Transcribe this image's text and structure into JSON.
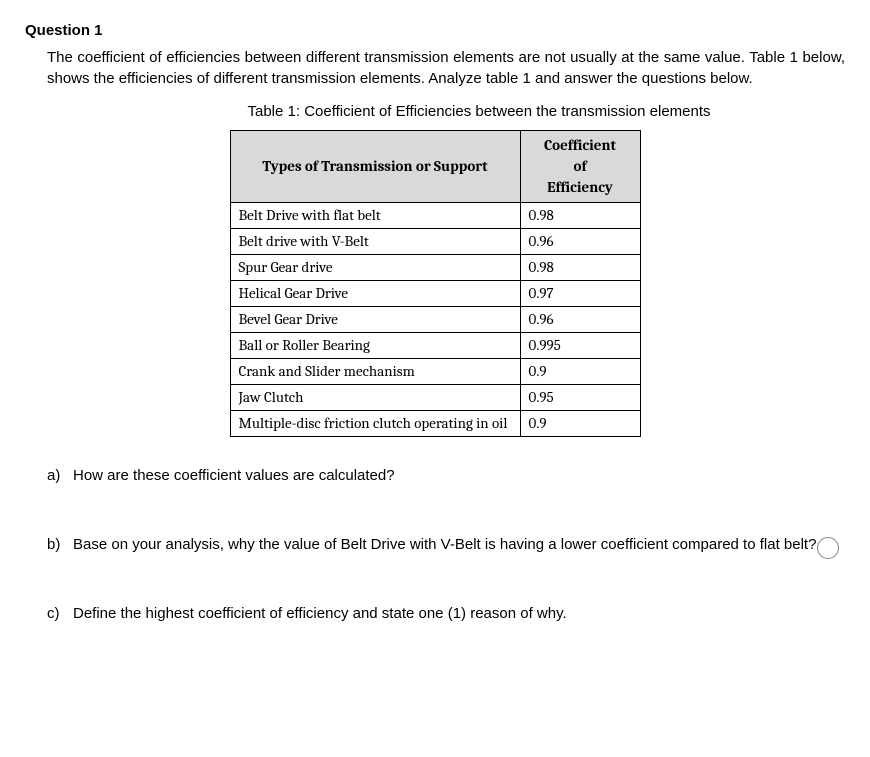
{
  "question_title": "Question 1",
  "intro": "The coefficient of efficiencies between different transmission elements are not usually at the same value. Table 1 below, shows the efficiencies of different transmission elements. Analyze table 1 and answer the questions below.",
  "table_caption": "Table 1: Coefficient of Efficiencies between the transmission elements",
  "headers": {
    "col1": "Types of Transmission or Support",
    "col2_line1": "Coefficient",
    "col2_line2": "of",
    "col2_line3": "Efficiency"
  },
  "rows": [
    {
      "type": "Belt Drive with flat belt",
      "coef": "0.98"
    },
    {
      "type": "Belt drive with V-Belt",
      "coef": "0.96"
    },
    {
      "type": "Spur Gear drive",
      "coef": "0.98"
    },
    {
      "type": "Helical Gear Drive",
      "coef": "0.97"
    },
    {
      "type": "Bevel Gear Drive",
      "coef": "0.96"
    },
    {
      "type": "Ball or Roller Bearing",
      "coef": "0.995"
    },
    {
      "type": "Crank and Slider mechanism",
      "coef": "0.9"
    },
    {
      "type": "Jaw Clutch",
      "coef": "0.95"
    },
    {
      "type": "Multiple-disc friction clutch operating in oil",
      "coef": "0.9"
    }
  ],
  "parts": {
    "a": {
      "marker": "a)",
      "text": "How are these coefficient values are calculated?"
    },
    "b": {
      "marker": "b)",
      "text": "Base on your analysis, why the value of Belt Drive with V-Belt is having a lower coefficient compared to flat belt?"
    },
    "c": {
      "marker": "c)",
      "text": "Define the highest coefficient of efficiency and state one (1) reason of why."
    }
  },
  "chart_data": {
    "type": "table",
    "title": "Coefficient of Efficiencies between the transmission elements",
    "columns": [
      "Types of Transmission or Support",
      "Coefficient of Efficiency"
    ],
    "data": [
      [
        "Belt Drive with flat belt",
        0.98
      ],
      [
        "Belt drive with V-Belt",
        0.96
      ],
      [
        "Spur Gear drive",
        0.98
      ],
      [
        "Helical Gear Drive",
        0.97
      ],
      [
        "Bevel Gear Drive",
        0.96
      ],
      [
        "Ball or Roller Bearing",
        0.995
      ],
      [
        "Crank and Slider mechanism",
        0.9
      ],
      [
        "Jaw Clutch",
        0.95
      ],
      [
        "Multiple-disc friction clutch operating in oil",
        0.9
      ]
    ]
  }
}
